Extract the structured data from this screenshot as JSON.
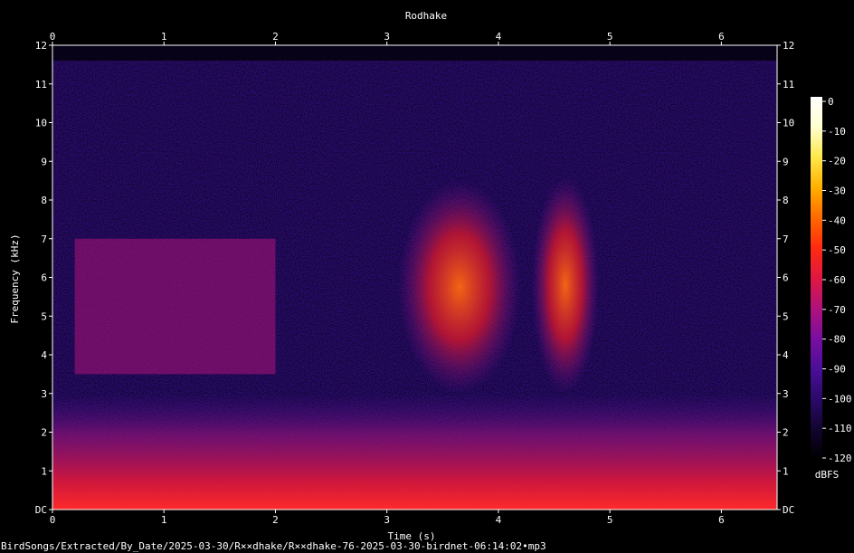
{
  "chart_data": {
    "type": "heatmap",
    "title": "Rodhake",
    "xlabel": "Time (s)",
    "ylabel": "Frequency (kHz)",
    "xlim": [
      0,
      6.5
    ],
    "ylim": [
      0,
      12
    ],
    "x_ticks": [
      "0",
      "1",
      "2",
      "3",
      "4",
      "5",
      "6"
    ],
    "y_ticks": [
      "DC",
      "1",
      "2",
      "3",
      "4",
      "5",
      "6",
      "7",
      "8",
      "9",
      "10",
      "11",
      "12"
    ],
    "colorbar": {
      "label": "dBFS",
      "ticks": [
        "0",
        "-10",
        "-20",
        "-30",
        "-40",
        "-50",
        "-60",
        "-70",
        "-80",
        "-90",
        "-100",
        "-110",
        "-120"
      ],
      "range": [
        -120,
        0
      ],
      "colors": [
        "#000000",
        "#120530",
        "#2a0a6a",
        "#4b0f9a",
        "#7a0fa0",
        "#b0127a",
        "#e01840",
        "#ff2a10",
        "#ff6a00",
        "#ffb000",
        "#ffe84a",
        "#ffffd0",
        "#ffffff"
      ]
    },
    "events": [
      {
        "t_start": 0.2,
        "t_end": 2.0,
        "f_low": 3.5,
        "f_high": 7.0,
        "level_db": -70
      },
      {
        "t_start": 3.1,
        "t_end": 4.2,
        "f_low": 3.0,
        "f_high": 8.5,
        "level_db": -45
      },
      {
        "t_start": 4.3,
        "t_end": 4.9,
        "f_low": 3.0,
        "f_high": 8.6,
        "level_db": -45
      }
    ],
    "background_db": -90,
    "low_freq_band": {
      "f_low": 0,
      "f_high": 2.5,
      "level_db": -60
    }
  },
  "file_path": "BirdSongs/Extracted/By_Date/2025-03-30/R××dhake/R××dhake-76-2025-03-30-birdnet-06:14:02•mp3"
}
